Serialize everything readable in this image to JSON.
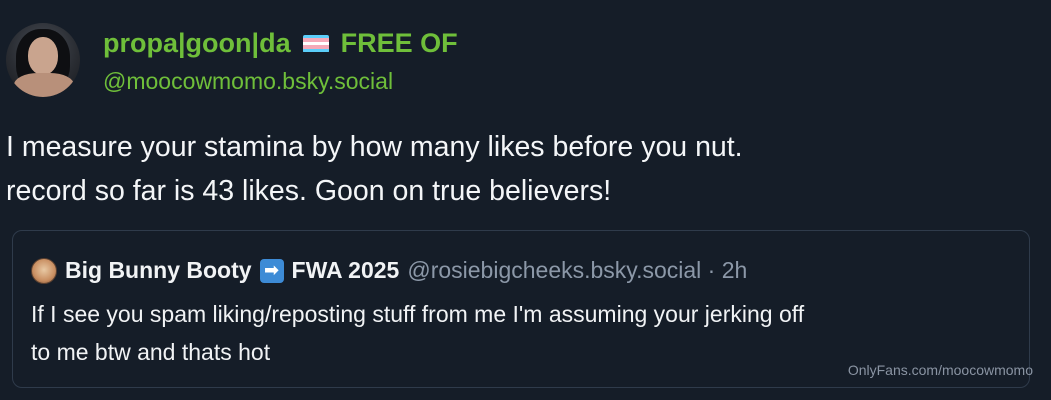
{
  "post": {
    "author": {
      "display_name_part1": "propa|goon|da",
      "flag": "trans-flag",
      "display_name_part2": "FREE OF",
      "handle": "@moocowmomo.bsky.social",
      "avatar_icon": "profile-photo"
    },
    "text_lines": [
      "I measure your stamina by how many likes before you nut.",
      "record so far is 43 likes. Goon on true believers!"
    ]
  },
  "quote": {
    "avatar_icon": "bunny-avatar",
    "display_name_part1": "Big Bunny Booty",
    "arrow_emoji": "➡",
    "display_name_part2": "FWA 2025",
    "handle_time": "@rosiebigcheeks.bsky.social · 2h",
    "text_lines": [
      "If I see you spam liking/reposting stuff from me I'm assuming your jerking off",
      "to me btw and thats hot"
    ]
  },
  "watermark": "OnlyFans.com/moocowmomo",
  "colors": {
    "background": "#151d28",
    "name_green": "#6fbf3a",
    "quote_border": "#2f3b4b",
    "muted": "#8c98a8"
  }
}
